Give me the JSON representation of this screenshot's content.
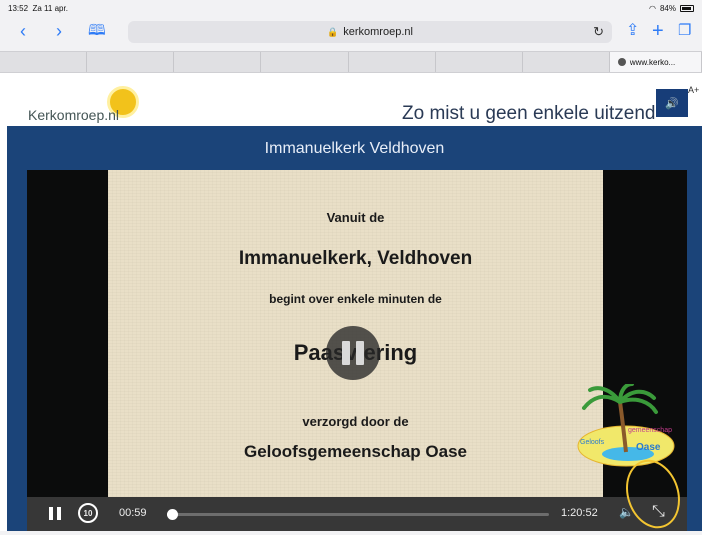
{
  "status": {
    "time": "13:52",
    "date": "Za 11 apr.",
    "battery": "84%"
  },
  "toolbar": {
    "back_icon": "chevron-left",
    "forward_icon": "chevron-right",
    "bookmarks_icon": "book",
    "share_icon": "share",
    "add_icon": "plus",
    "tabs_icon": "tabs"
  },
  "address": {
    "url": "kerkomroep.nl",
    "reload_icon": "reload"
  },
  "tabs": [
    {
      "label": ""
    },
    {
      "label": ""
    },
    {
      "label": ""
    },
    {
      "label": ""
    },
    {
      "label": ""
    },
    {
      "label": ""
    },
    {
      "label": ""
    },
    {
      "label": "www.kerko..."
    }
  ],
  "site": {
    "logo_text": "Kerkomroep.nl",
    "tagline": "Zo mist u geen enkele uitzend",
    "text_size": "A+"
  },
  "player": {
    "title": "Immanuelkerk Veldhoven",
    "slide": {
      "line1": "Vanuit de",
      "line2": "Immanuelkerk, Veldhoven",
      "line3": "begint over enkele minuten de",
      "line4": "Paasviering",
      "line5": "verzorgd door de",
      "line6": "Geloofsgemeenschap  Oase"
    },
    "oase_logo": {
      "top_text": "gemeenschap",
      "left_text": "Geloofs",
      "name": "Oase"
    },
    "current_time": "00:59",
    "total_time": "1:20:52",
    "progress": 0.012,
    "rewind_label": "10"
  },
  "colors": {
    "accent": "#2f7cf6",
    "overlay": "#1b4479",
    "annotation": "#f3c531"
  }
}
